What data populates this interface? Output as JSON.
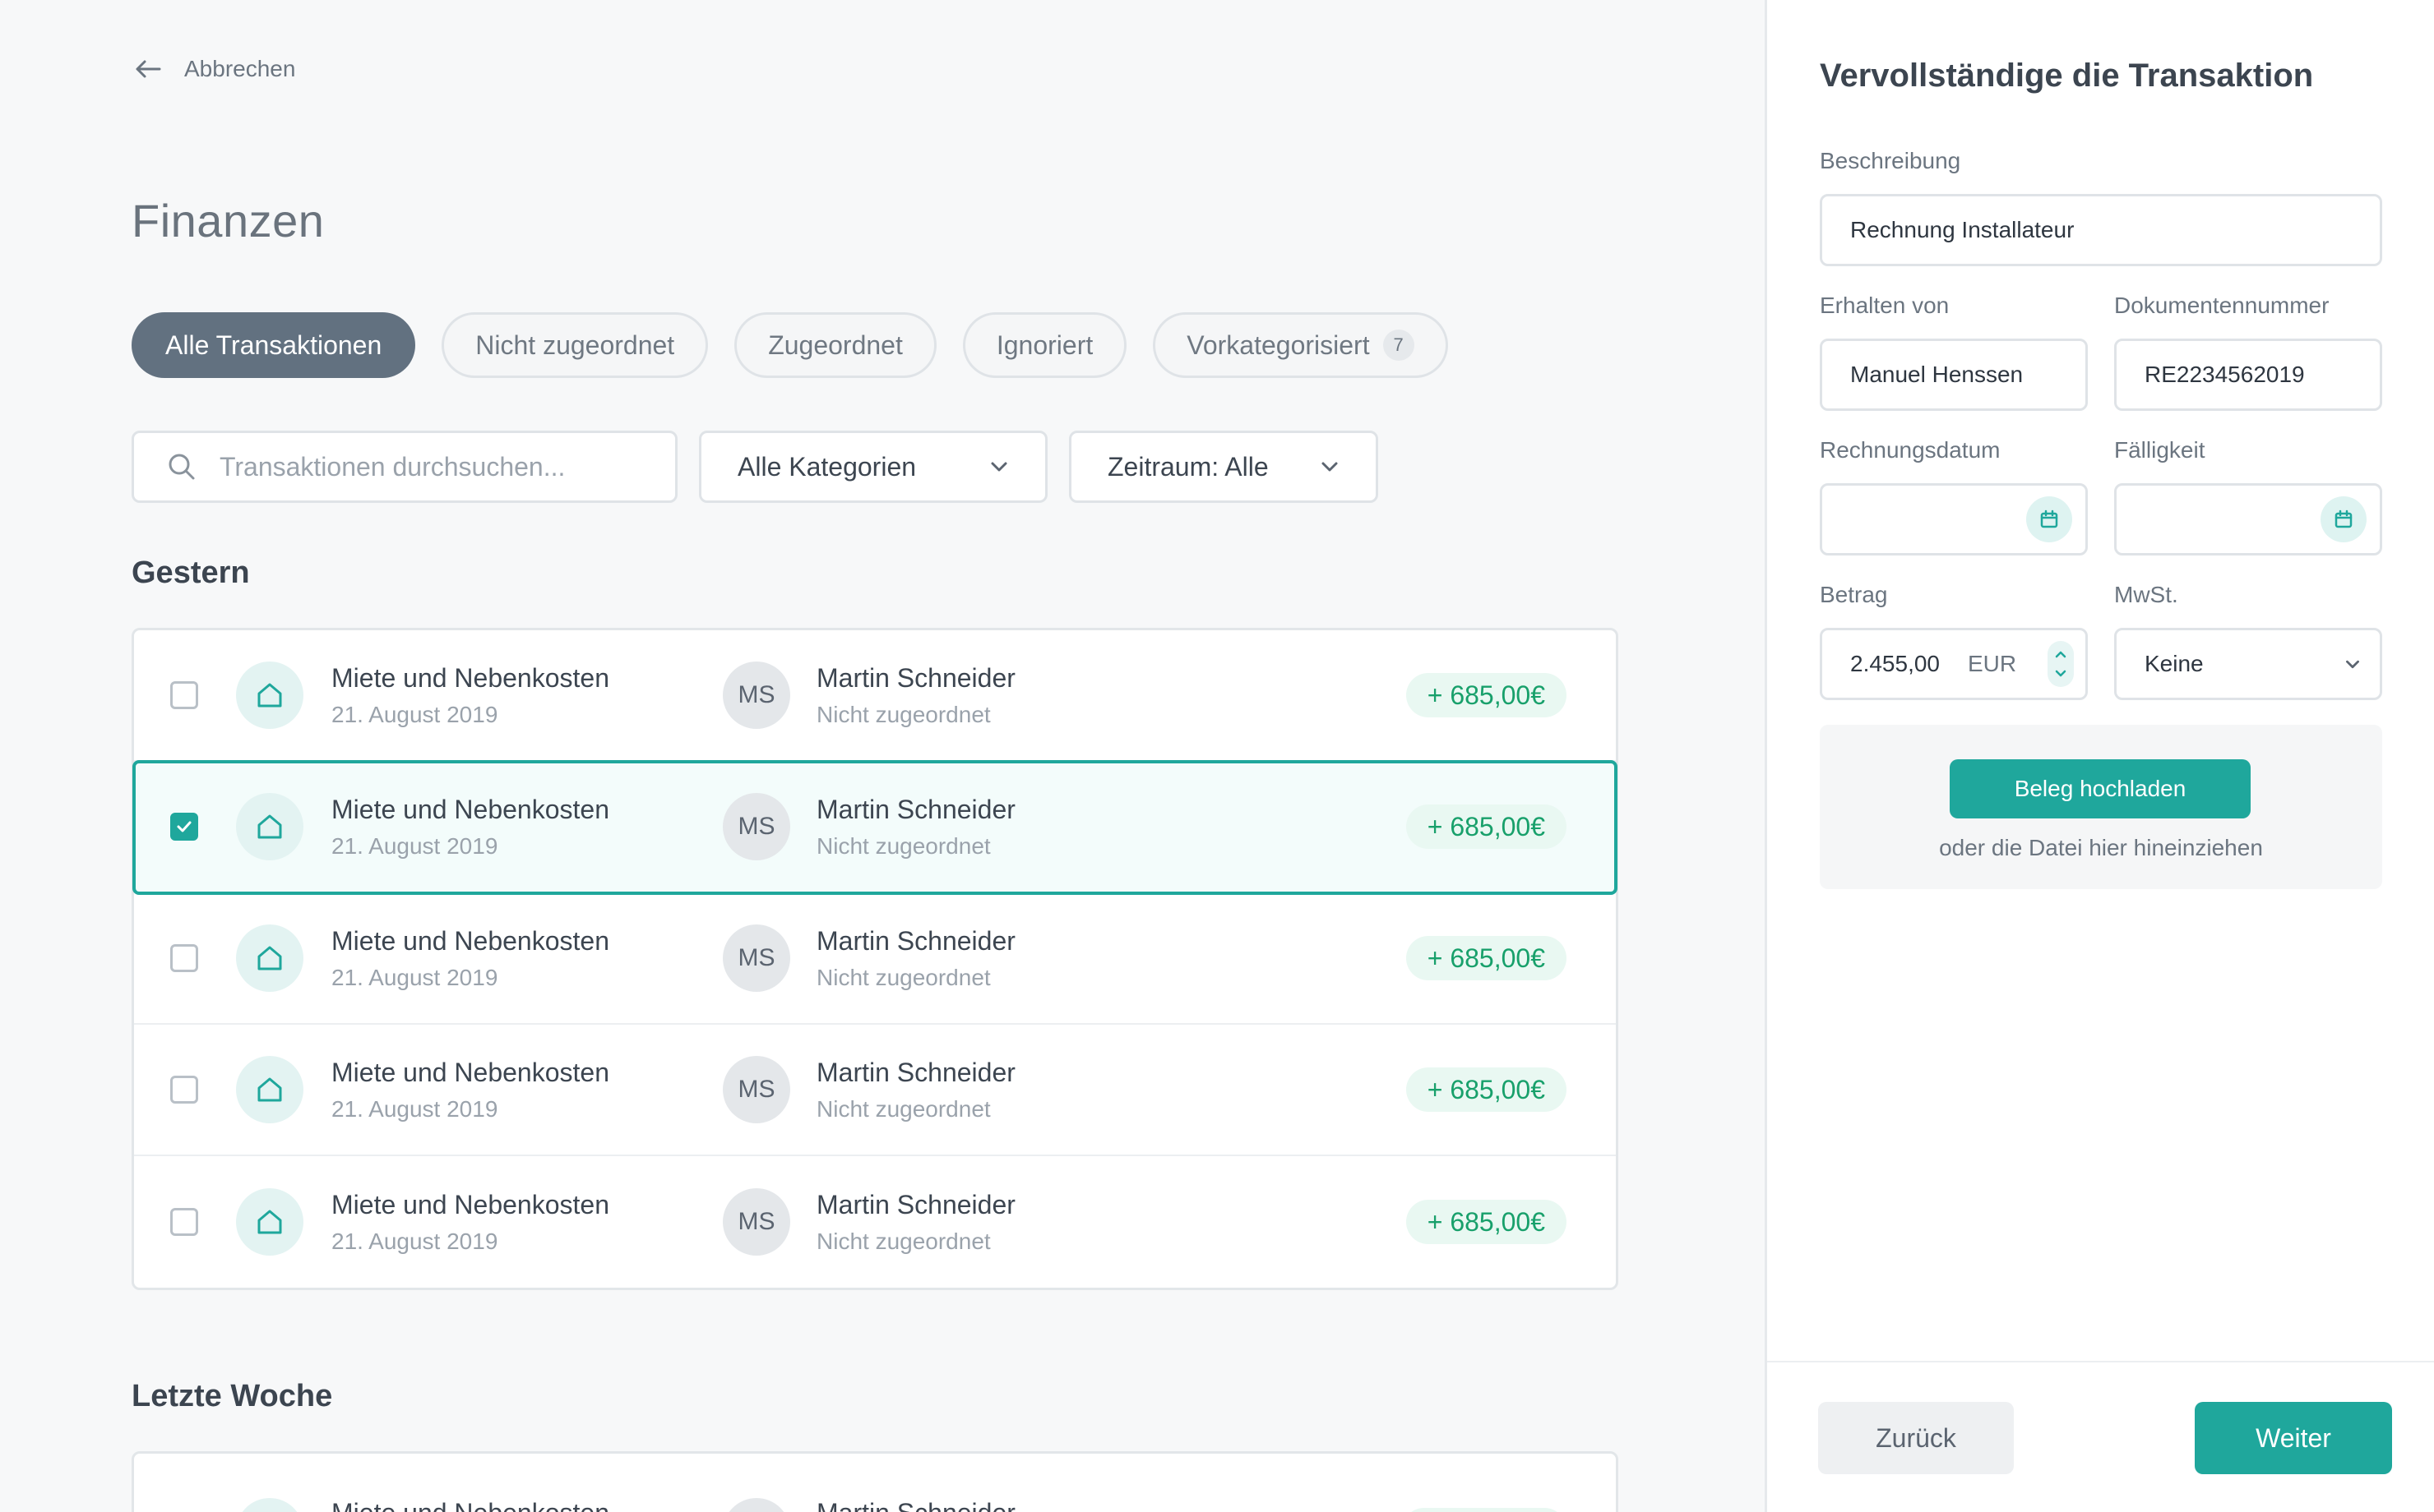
{
  "nav": {
    "back_label": "Abbrechen"
  },
  "page": {
    "title": "Finanzen"
  },
  "tabs": [
    {
      "label": "Alle Transaktionen",
      "active": true
    },
    {
      "label": "Nicht zugeordnet"
    },
    {
      "label": "Zugeordnet"
    },
    {
      "label": "Ignoriert"
    },
    {
      "label": "Vorkategorisiert",
      "count": "7"
    }
  ],
  "filters": {
    "search_placeholder": "Transaktionen durchsuchen...",
    "category": "Alle Kategorien",
    "period": "Zeitraum: Alle"
  },
  "sections": {
    "yesterday": {
      "title": "Gestern",
      "transactions": [
        {
          "title": "Miete und Nebenkosten",
          "date": "21. August 2019",
          "initials": "MS",
          "name": "Martin Schneider",
          "status": "Nicht zugeordnet",
          "amount": "+ 685,00€",
          "checked": false
        },
        {
          "title": "Miete und Nebenkosten",
          "date": "21. August 2019",
          "initials": "MS",
          "name": "Martin Schneider",
          "status": "Nicht zugeordnet",
          "amount": "+ 685,00€",
          "checked": true
        },
        {
          "title": "Miete und Nebenkosten",
          "date": "21. August 2019",
          "initials": "MS",
          "name": "Martin Schneider",
          "status": "Nicht zugeordnet",
          "amount": "+ 685,00€",
          "checked": false
        },
        {
          "title": "Miete und Nebenkosten",
          "date": "21. August 2019",
          "initials": "MS",
          "name": "Martin Schneider",
          "status": "Nicht zugeordnet",
          "amount": "+ 685,00€",
          "checked": false
        },
        {
          "title": "Miete und Nebenkosten",
          "date": "21. August 2019",
          "initials": "MS",
          "name": "Martin Schneider",
          "status": "Nicht zugeordnet",
          "amount": "+ 685,00€",
          "checked": false
        }
      ]
    },
    "last_week": {
      "title": "Letzte Woche",
      "transactions": [
        {
          "title": "Miete und Nebenkosten",
          "initials": "MS",
          "name": "Martin Schneider"
        }
      ]
    }
  },
  "panel": {
    "title": "Vervollständige die Transaktion",
    "description_label": "Beschreibung",
    "description_value": "Rechnung Installateur",
    "received_from_label": "Erhalten von",
    "received_from_value": "Manuel Henssen",
    "doc_number_label": "Dokumentennummer",
    "doc_number_value": "RE2234562019",
    "invoice_date_label": "Rechnungsdatum",
    "due_label": "Fälligkeit",
    "amount_label": "Betrag",
    "amount_value": "2.455,00",
    "currency": "EUR",
    "vat_label": "MwSt.",
    "vat_value": "Keine",
    "upload_label": "Beleg hochladen",
    "drop_hint": "oder die Datei hier hineinziehen",
    "back_label": "Zurück",
    "next_label": "Weiter"
  },
  "colors": {
    "accent": "#1fa79c",
    "active_tab": "#627180",
    "amount_positive": "#18a06b"
  },
  "icons": {
    "back": "arrow-left-icon",
    "search": "search-icon",
    "dropdown": "chevron-down-icon",
    "category": "house-icon",
    "calendar": "calendar-icon",
    "checkbox": "check-icon"
  }
}
